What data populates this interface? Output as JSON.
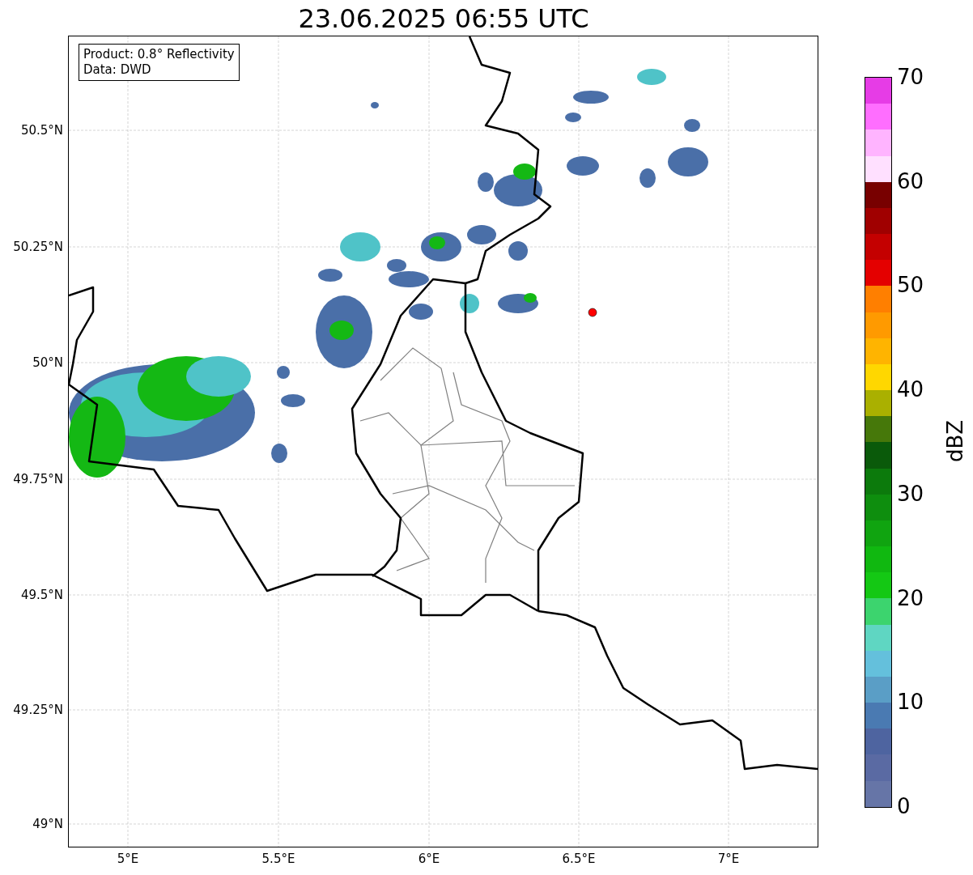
{
  "title": "23.06.2025 06:55 UTC",
  "info_box": {
    "lines": [
      "Product: 0.8° Reflectivity",
      "Data: DWD"
    ]
  },
  "map": {
    "y_ticks": [
      "50.5°N",
      "50.25°N",
      "50°N",
      "49.75°N",
      "49.5°N",
      "49.25°N",
      "49°N"
    ],
    "x_ticks": [
      "5°E",
      "5.5°E",
      "6°E",
      "6.5°E",
      "7°E"
    ]
  },
  "colorbar": {
    "label": "dBZ",
    "ticks": [
      "70",
      "60",
      "50",
      "40",
      "30",
      "20",
      "10",
      "0"
    ],
    "bins": [
      {
        "color": "#e63ce6"
      },
      {
        "color": "#ff6eff"
      },
      {
        "color": "#ffb4ff"
      },
      {
        "color": "#ffe0ff"
      },
      {
        "color": "#780000"
      },
      {
        "color": "#a00000"
      },
      {
        "color": "#c40000"
      },
      {
        "color": "#e40000"
      },
      {
        "color": "#ff7f00"
      },
      {
        "color": "#ff9a00"
      },
      {
        "color": "#ffb400"
      },
      {
        "color": "#ffd700"
      },
      {
        "color": "#aab000"
      },
      {
        "color": "#46780a"
      },
      {
        "color": "#0a5a0a"
      },
      {
        "color": "#0c7a0c"
      },
      {
        "color": "#0e8e0e"
      },
      {
        "color": "#10a410"
      },
      {
        "color": "#10b810"
      },
      {
        "color": "#14c814"
      },
      {
        "color": "#3cd46e"
      },
      {
        "color": "#5fd6c2"
      },
      {
        "color": "#64c0dc"
      },
      {
        "color": "#5a9ec6"
      },
      {
        "color": "#4a7ab2"
      },
      {
        "color": "#4e64a0"
      },
      {
        "color": "#5a6aa3"
      },
      {
        "color": "#6675a7"
      }
    ]
  }
}
